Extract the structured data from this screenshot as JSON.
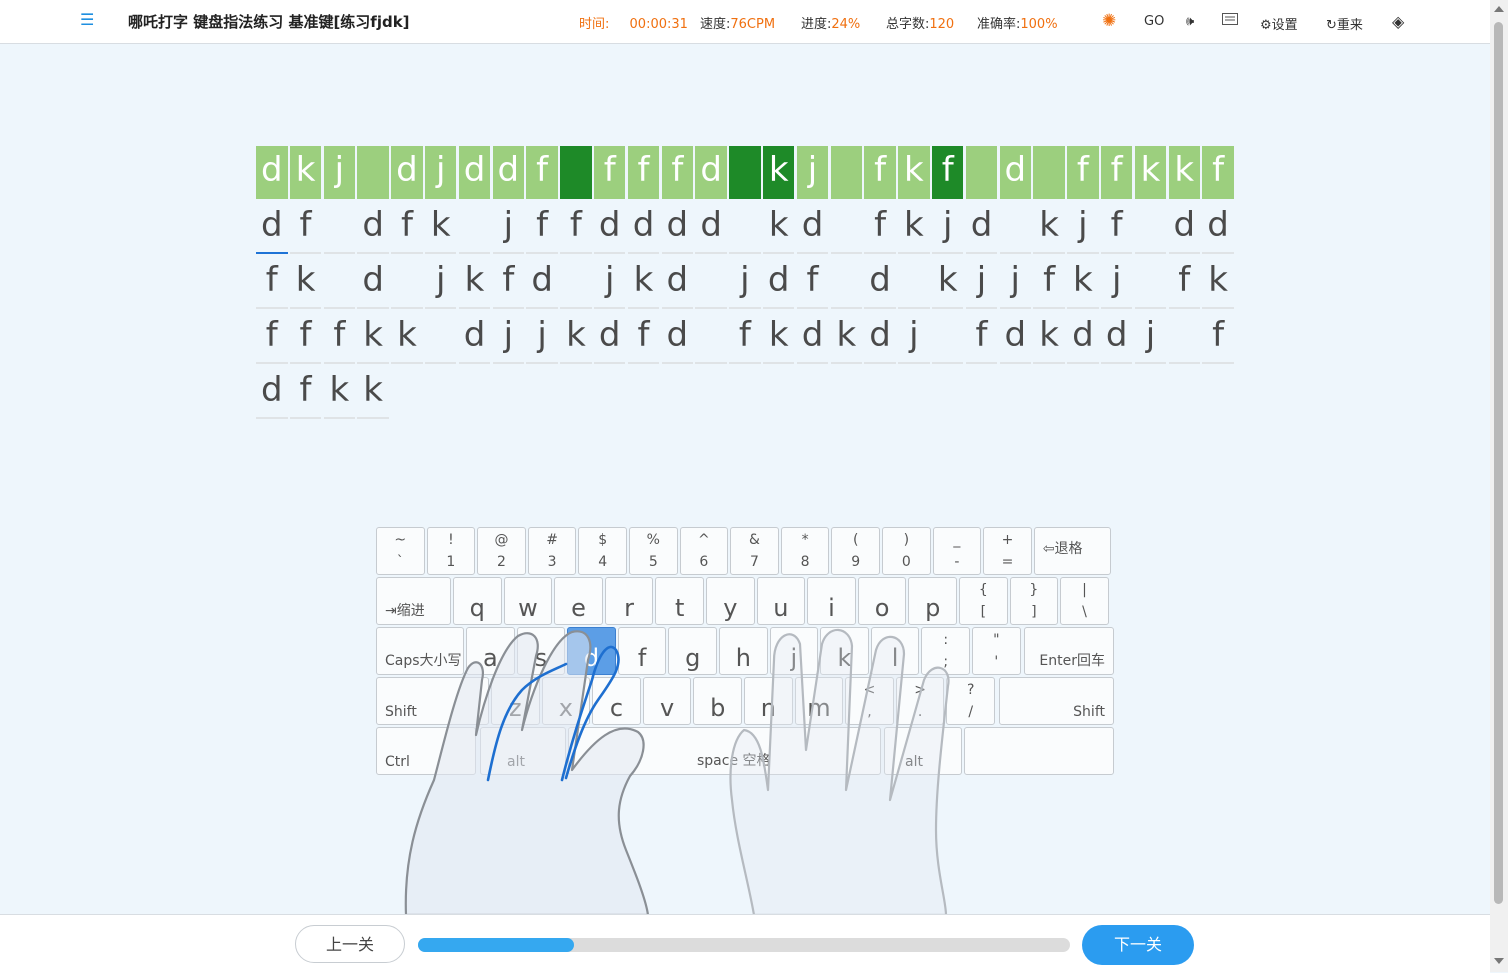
{
  "header": {
    "title": "哪吒打字 键盘指法练习 基准键[练习fjdk]",
    "stats": [
      {
        "label": "时间:",
        "value": "00:00:31"
      },
      {
        "label": "速度:",
        "value": "76CPM"
      },
      {
        "label": "进度:",
        "value": "24%"
      },
      {
        "label": "总字数:",
        "value": "120"
      },
      {
        "label": "准确率:",
        "value": "100%"
      }
    ],
    "tools": {
      "go": "GO",
      "settings": "设置",
      "restart": "重来"
    }
  },
  "practice": {
    "target_row": [
      "d",
      "k",
      "j",
      " ",
      "d",
      "j",
      "d",
      "d",
      "f",
      " ",
      "f",
      "f",
      "f",
      "d",
      " ",
      "k",
      "j",
      " ",
      "f",
      "k",
      "f",
      " ",
      "d",
      " ",
      "f",
      "f",
      "k",
      "k",
      "f"
    ],
    "highlighted_indices": [
      9,
      14,
      15,
      20
    ],
    "input_rows": [
      [
        "d",
        "f",
        " ",
        "d",
        "f",
        "k",
        " ",
        "j",
        "f",
        "f",
        "d",
        "d",
        "d",
        "d",
        " ",
        "k",
        "d",
        " ",
        "f",
        "k",
        "j",
        "d",
        " ",
        "k",
        "j",
        "f",
        " ",
        "d",
        "d"
      ],
      [
        "f",
        "k",
        " ",
        "d",
        " ",
        "j",
        "k",
        "f",
        "d",
        " ",
        "j",
        "k",
        "d",
        " ",
        "j",
        "d",
        "f",
        " ",
        "d",
        " ",
        "k",
        "j",
        "j",
        "f",
        "k",
        "j",
        " ",
        "f",
        "k"
      ],
      [
        "f",
        "f",
        "f",
        "k",
        "k",
        " ",
        "d",
        "j",
        "j",
        "k",
        "d",
        "f",
        "d",
        " ",
        "f",
        "k",
        "d",
        "k",
        "d",
        "j",
        " ",
        "f",
        "d",
        "k",
        "d",
        "d",
        "j",
        " ",
        "f"
      ],
      [
        "d",
        "f",
        "k",
        "k"
      ]
    ]
  },
  "keyboard": {
    "row1": [
      {
        "top": "~",
        "bot": "`"
      },
      {
        "top": "!",
        "bot": "1"
      },
      {
        "top": "@",
        "bot": "2"
      },
      {
        "top": "#",
        "bot": "3"
      },
      {
        "top": "$",
        "bot": "4"
      },
      {
        "top": "%",
        "bot": "5"
      },
      {
        "top": "^",
        "bot": "6"
      },
      {
        "top": "&",
        "bot": "7"
      },
      {
        "top": "*",
        "bot": "8"
      },
      {
        "top": "(",
        "bot": "9"
      },
      {
        "top": ")",
        "bot": "0"
      },
      {
        "top": "_",
        "bot": "-"
      },
      {
        "top": "+",
        "bot": "="
      }
    ],
    "backspace": "⇦退格",
    "tab": "⇥缩进",
    "row2": [
      "q",
      "w",
      "e",
      "r",
      "t",
      "y",
      "u",
      "i",
      "o",
      "p"
    ],
    "row2_sym": [
      {
        "top": "{",
        "bot": "["
      },
      {
        "top": "}",
        "bot": "]"
      },
      {
        "top": "|",
        "bot": "\\"
      }
    ],
    "caps": "Caps大小写",
    "row3": [
      "a",
      "s",
      "d",
      "f",
      "g",
      "h",
      "j",
      "k",
      "l"
    ],
    "row3_sym": [
      {
        "top": ":",
        "bot": ";"
      },
      {
        "top": "\"",
        "bot": "'"
      }
    ],
    "enter": "Enter回车",
    "shift_left": "Shift",
    "row4": [
      "z",
      "x",
      "c",
      "v",
      "b",
      "n",
      "m"
    ],
    "row4_sym": [
      {
        "top": "<",
        "bot": ","
      },
      {
        "top": ">",
        "bot": "."
      },
      {
        "top": "?",
        "bot": "/"
      }
    ],
    "shift_right": "Shift",
    "ctrl": "Ctrl",
    "alt_left": "alt",
    "space": "space 空格",
    "alt_right": "alt",
    "active_key": "d"
  },
  "footer": {
    "prev": "上一关",
    "next": "下一关",
    "progress": 0.24
  },
  "colors": {
    "accent": "#2b9cf0",
    "target_bg": "#9ccf7e",
    "target_hl": "#1e8a28",
    "stat_value": "#f07010"
  }
}
